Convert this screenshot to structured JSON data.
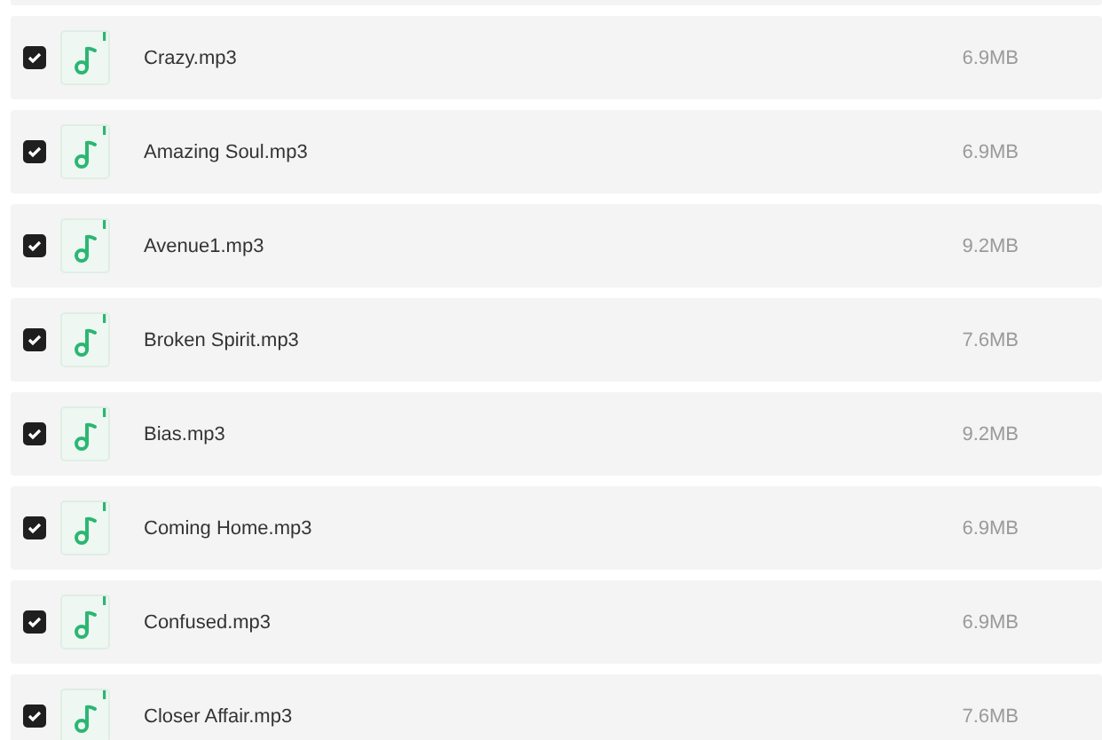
{
  "files": [
    {
      "name": "Crazy.mp3",
      "size": "6.9MB",
      "checked": true
    },
    {
      "name": "Amazing Soul.mp3",
      "size": "6.9MB",
      "checked": true
    },
    {
      "name": "Avenue1.mp3",
      "size": "9.2MB",
      "checked": true
    },
    {
      "name": "Broken Spirit.mp3",
      "size": "7.6MB",
      "checked": true
    },
    {
      "name": "Bias.mp3",
      "size": "9.2MB",
      "checked": true
    },
    {
      "name": "Coming Home.mp3",
      "size": "6.9MB",
      "checked": true
    },
    {
      "name": "Confused.mp3",
      "size": "6.9MB",
      "checked": true
    },
    {
      "name": "Closer Affair.mp3",
      "size": "7.6MB",
      "checked": true
    }
  ]
}
